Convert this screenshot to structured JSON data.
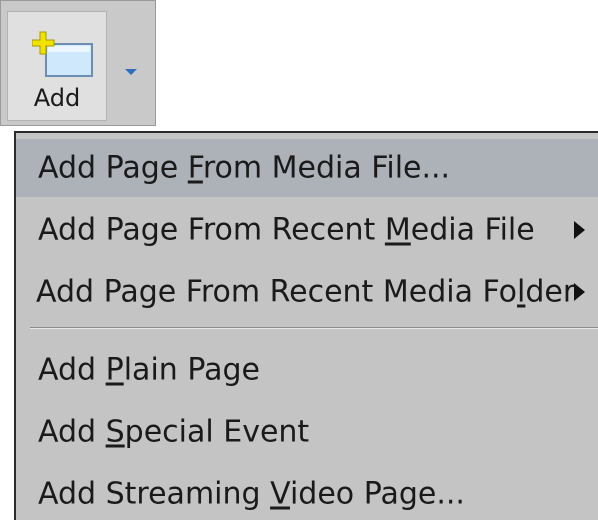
{
  "toolbar": {
    "add_label": "Add",
    "add_icon": "new-page-icon",
    "dropdown_icon": "dropdown-arrow-icon"
  },
  "menu": {
    "items": [
      {
        "pre": "Add Page ",
        "key": "F",
        "post": "rom Media File...",
        "highlighted": true,
        "submenu": false
      },
      {
        "pre": "Add Page From Recent ",
        "key": "M",
        "post": "edia File",
        "highlighted": false,
        "submenu": true
      },
      {
        "pre": "Add Page From Recent Media Fo",
        "key": "l",
        "post": "der",
        "highlighted": false,
        "submenu": true
      },
      {
        "pre": "Add ",
        "key": "P",
        "post": "lain Page",
        "highlighted": false,
        "submenu": false
      },
      {
        "pre": "Add ",
        "key": "S",
        "post": "pecial Event",
        "highlighted": false,
        "submenu": false
      },
      {
        "pre": "Add Streaming ",
        "key": "V",
        "post": "ideo Page...",
        "highlighted": false,
        "submenu": false
      }
    ]
  },
  "colors": {
    "menu_background": "#c4c4c4",
    "highlight": "#adb1b8",
    "dropdown_arrow": "#2f6ebf",
    "icon_plus": "#f2e200"
  }
}
